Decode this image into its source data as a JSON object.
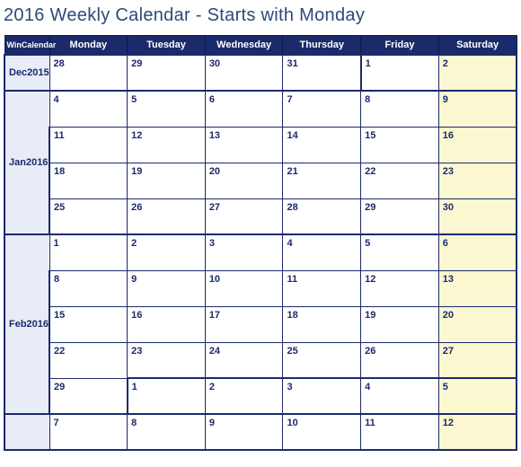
{
  "title": "2016 Weekly Calendar - Starts with Monday",
  "corner": "WinCalendar",
  "days": [
    "Monday",
    "Tuesday",
    "Wednesday",
    "Thursday",
    "Friday",
    "Saturday"
  ],
  "months": {
    "dec2015": "Dec2015",
    "jan2016": "Jan2016",
    "feb2016": "Feb2016",
    "blank": ""
  },
  "rows": {
    "r0": [
      "28",
      "29",
      "30",
      "31",
      "1",
      "2"
    ],
    "r1": [
      "4",
      "5",
      "6",
      "7",
      "8",
      "9"
    ],
    "r2": [
      "11",
      "12",
      "13",
      "14",
      "15",
      "16"
    ],
    "r3": [
      "18",
      "19",
      "20",
      "21",
      "22",
      "23"
    ],
    "r4": [
      "25",
      "26",
      "27",
      "28",
      "29",
      "30"
    ],
    "r5": [
      "1",
      "2",
      "3",
      "4",
      "5",
      "6"
    ],
    "r6": [
      "8",
      "9",
      "10",
      "11",
      "12",
      "13"
    ],
    "r7": [
      "15",
      "16",
      "17",
      "18",
      "19",
      "20"
    ],
    "r8": [
      "22",
      "23",
      "24",
      "25",
      "26",
      "27"
    ],
    "r9": [
      "29",
      "1",
      "2",
      "3",
      "4",
      "5"
    ],
    "r10": [
      "7",
      "8",
      "9",
      "10",
      "11",
      "12"
    ]
  }
}
